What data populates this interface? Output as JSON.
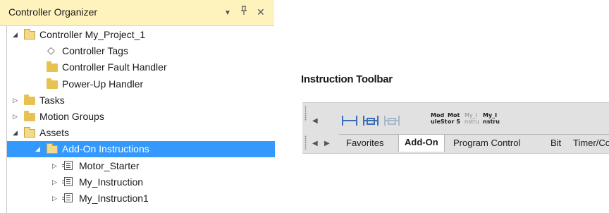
{
  "organizer": {
    "title": "Controller Organizer",
    "tree": [
      {
        "label": "Controller My_Project_1",
        "icon": "folder-open-icon",
        "expander": "expanded",
        "level": 0
      },
      {
        "label": "Controller Tags",
        "icon": "tag-icon",
        "expander": "none",
        "level": 1
      },
      {
        "label": "Controller Fault Handler",
        "icon": "folder-icon",
        "expander": "none",
        "level": 1
      },
      {
        "label": "Power-Up Handler",
        "icon": "folder-icon",
        "expander": "none",
        "level": 1
      },
      {
        "label": "Tasks",
        "icon": "folder-icon",
        "expander": "collapsed",
        "level": 0
      },
      {
        "label": "Motion Groups",
        "icon": "folder-icon",
        "expander": "collapsed",
        "level": 0
      },
      {
        "label": "Assets",
        "icon": "folder-open-icon",
        "expander": "expanded",
        "level": 0
      },
      {
        "label": "Add-On Instructions",
        "icon": "folder-open-icon",
        "expander": "expanded",
        "level": 1,
        "selected": true
      },
      {
        "label": "Motor_Starter",
        "icon": "add-on-instruction-icon",
        "expander": "collapsed",
        "level": 2
      },
      {
        "label": "My_Instruction",
        "icon": "add-on-instruction-icon",
        "expander": "collapsed",
        "level": 2
      },
      {
        "label": "My_Instruction1",
        "icon": "add-on-instruction-icon",
        "expander": "collapsed",
        "level": 2
      }
    ]
  },
  "toolbar": {
    "heading": "Instruction Toolbar",
    "instruction_icons": [
      "xic-rung-icon",
      "branch-icon",
      "branch-level-icon"
    ],
    "aoi_buttons": [
      {
        "line1": "Mod",
        "line2": "uleSt",
        "dim": false
      },
      {
        "line1": "Mot",
        "line2": "or S",
        "dim": false
      },
      {
        "line1": "My_I",
        "line2": "nstru",
        "dim": true
      },
      {
        "line1": "My_I",
        "line2": "nstru",
        "dim": false
      }
    ],
    "tabs": [
      "Favorites",
      "Add-On",
      "Program Control",
      "Bit",
      "Timer/Co"
    ],
    "active_tab": "Add-On"
  },
  "colors": {
    "header_bg": "#fef2bd",
    "selection": "#3399ff",
    "folder": "#e8c153",
    "instruction_blue": "#3b6db5",
    "toolbar_bg": "#e1e1e1"
  }
}
